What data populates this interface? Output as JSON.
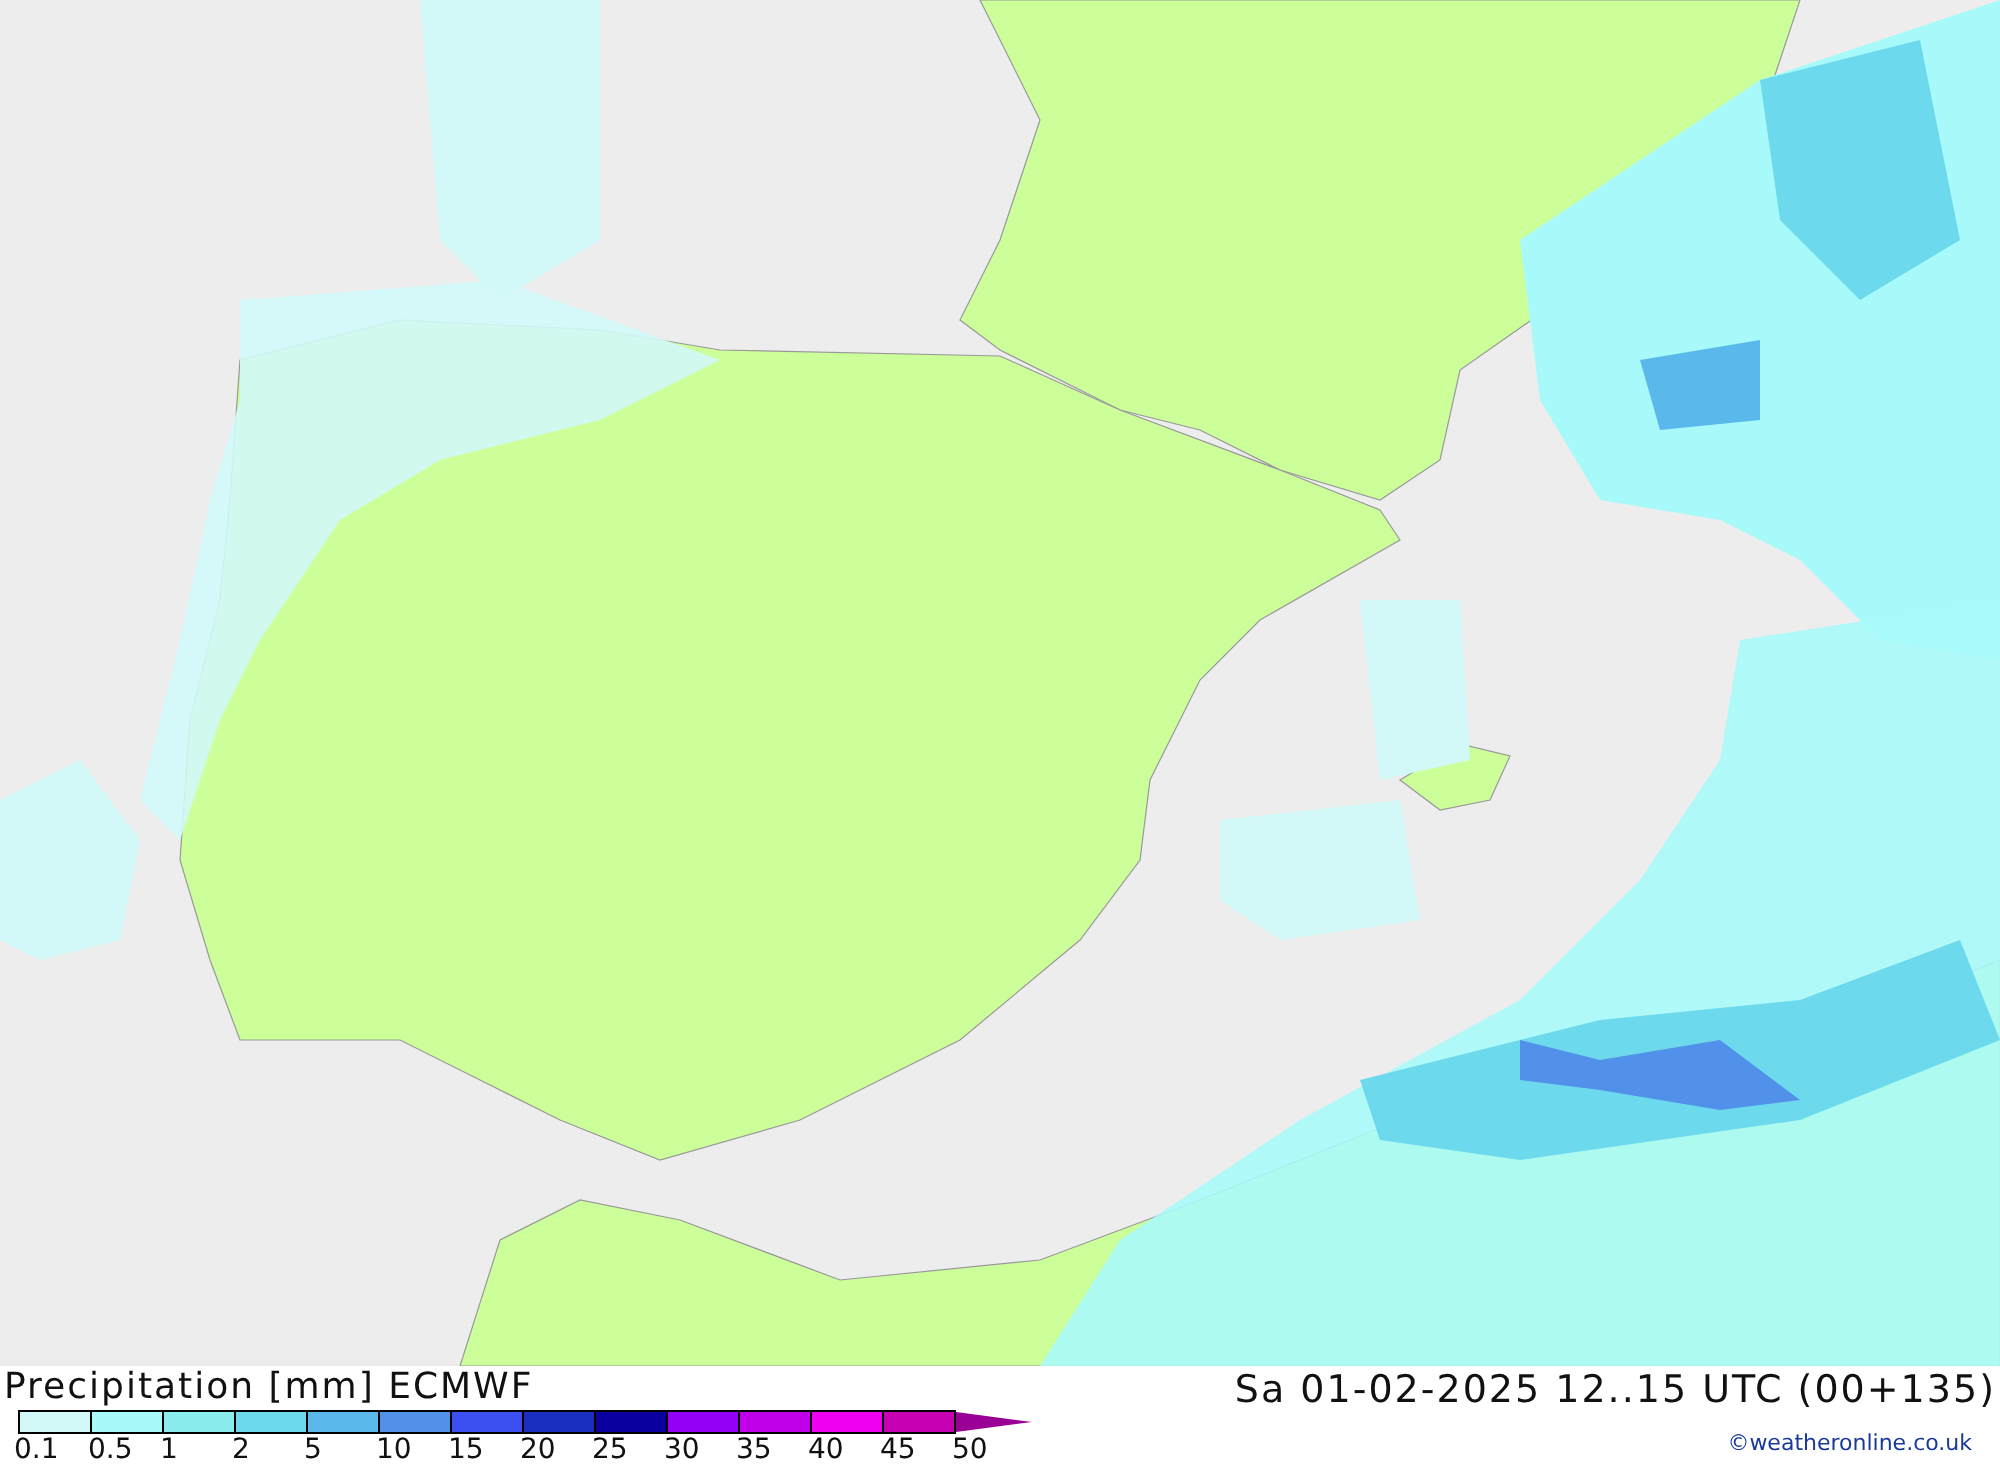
{
  "title": "Precipitation [mm] ECMWF",
  "valid_time": "Sa 01-02-2025 12..15 UTC (00+135)",
  "credit": "©weatheronline.co.uk",
  "legend": {
    "bins": [
      {
        "label": "0.1",
        "color": "#d2f8f8"
      },
      {
        "label": "0.5",
        "color": "#a8fafa"
      },
      {
        "label": "1",
        "color": "#8aeced"
      },
      {
        "label": "2",
        "color": "#6cd9ec"
      },
      {
        "label": "5",
        "color": "#5ab9ea"
      },
      {
        "label": "10",
        "color": "#5291ea"
      },
      {
        "label": "15",
        "color": "#3c50f2"
      },
      {
        "label": "20",
        "color": "#1a2ec0"
      },
      {
        "label": "25",
        "color": "#0a00a0"
      },
      {
        "label": "30",
        "color": "#9200f5"
      },
      {
        "label": "35",
        "color": "#c000e8"
      },
      {
        "label": "40",
        "color": "#f000f0"
      },
      {
        "label": "45",
        "color": "#c800b4"
      }
    ],
    "end_label": "50"
  }
}
